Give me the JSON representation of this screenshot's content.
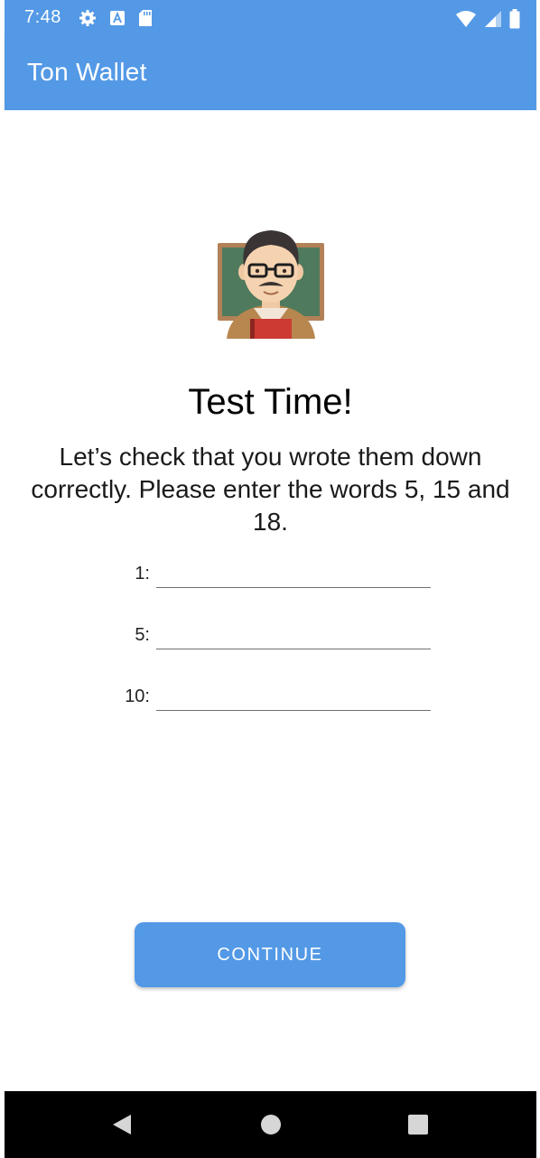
{
  "status_bar": {
    "time": "7:48",
    "icons_left": [
      "gear-icon",
      "a-badge-icon",
      "sd-card-icon"
    ],
    "icons_right": [
      "wifi-icon",
      "signal-icon",
      "battery-icon"
    ],
    "color": "#5399e6"
  },
  "app_bar": {
    "title": "Ton Wallet",
    "color": "#5399e6"
  },
  "main": {
    "illustration_icon": "teacher-emoji-icon",
    "heading": "Test Time!",
    "subtitle": "Let’s check that you wrote them down correctly. Please enter the words 5, 15 and 18.",
    "fields": [
      {
        "label": "1:",
        "value": ""
      },
      {
        "label": "5:",
        "value": ""
      },
      {
        "label": "10:",
        "value": ""
      }
    ],
    "continue_label": "CONTINUE",
    "accent_color": "#5399e6"
  },
  "nav_bar": {
    "buttons": [
      "back-icon",
      "home-icon",
      "recents-icon"
    ]
  }
}
